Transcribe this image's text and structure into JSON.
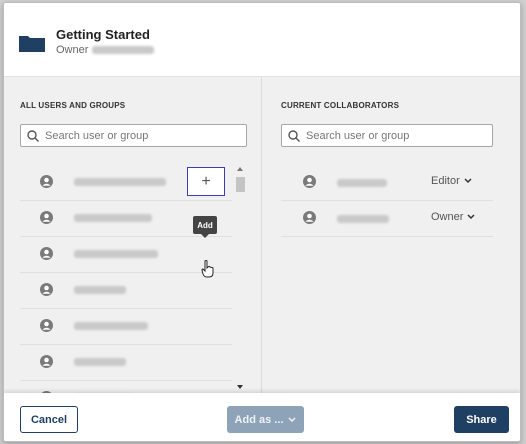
{
  "header": {
    "title": "Getting Started",
    "owner_label": "Owner"
  },
  "left_panel": {
    "section_title": "ALL USERS AND GROUPS",
    "search_placeholder": "Search user or group",
    "tooltip": "Add",
    "add_symbol": "+",
    "rows": [
      {
        "avatar": "user-avatar-icon"
      },
      {
        "avatar": "user-avatar-icon"
      },
      {
        "avatar": "user-avatar-icon"
      },
      {
        "avatar": "user-avatar-icon"
      },
      {
        "avatar": "user-avatar-icon"
      },
      {
        "avatar": "user-avatar-icon"
      }
    ]
  },
  "right_panel": {
    "section_title": "CURRENT COLLABORATORS",
    "search_placeholder": "Search user or group",
    "collaborators": [
      {
        "role": "Editor"
      },
      {
        "role": "Owner"
      }
    ]
  },
  "footer": {
    "cancel": "Cancel",
    "add_as": "Add as ...",
    "share": "Share"
  },
  "colors": {
    "primary": "#1f3f63",
    "disabled": "#8fa3b8"
  }
}
